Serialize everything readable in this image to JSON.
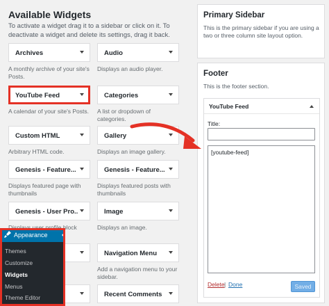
{
  "available_widgets": {
    "title": "Available Widgets",
    "intro": "To activate a widget drag it to a sidebar or click on it. To deactivate a widget and delete its settings, drag it back.",
    "widgets": [
      {
        "title": "Archives",
        "desc": "A monthly archive of your site's Posts."
      },
      {
        "title": "Audio",
        "desc": "Displays an audio player."
      },
      {
        "title": "YouTube Feed",
        "desc": "A calendar of your site's Posts."
      },
      {
        "title": "Categories",
        "desc": "A list or dropdown of categories."
      },
      {
        "title": "Custom HTML",
        "desc": "Arbitrary HTML code."
      },
      {
        "title": "Gallery",
        "desc": "Displays an image gallery."
      },
      {
        "title": "Genesis - Feature...",
        "desc": "Displays featured page with thumbnails"
      },
      {
        "title": "Genesis - Feature...",
        "desc": "Displays featured posts with thumbnails"
      },
      {
        "title": "Genesis - User Pro...",
        "desc": "Displays user profile block"
      },
      {
        "title": "Image",
        "desc": "Displays an image."
      },
      {
        "title": "",
        "desc": "ess.org"
      },
      {
        "title": "Navigation Menu",
        "desc": "Add a navigation menu to your sidebar."
      },
      {
        "title": "",
        "desc": ""
      },
      {
        "title": "Recent Comments",
        "desc": ""
      }
    ]
  },
  "primary_sidebar": {
    "title": "Primary Sidebar",
    "desc": "This is the primary sidebar if you are using a two or three column site layout option."
  },
  "footer": {
    "title": "Footer",
    "desc": "This is the footer section.",
    "widget": {
      "title": "YouTube Feed",
      "title_label": "Title:",
      "title_value": "",
      "content": "[youtube-feed]",
      "delete_label": "Delete",
      "separator": "|",
      "done_label": "Done",
      "saved_label": "Saved"
    }
  },
  "admin_menu": {
    "header": "Appearance",
    "items": [
      "Themes",
      "Customize",
      "Widgets",
      "Menus",
      "Theme Editor"
    ],
    "active": "Widgets"
  },
  "colors": {
    "highlight": "#e43125",
    "admin_blue": "#0073aa",
    "admin_dark": "#23282d"
  }
}
